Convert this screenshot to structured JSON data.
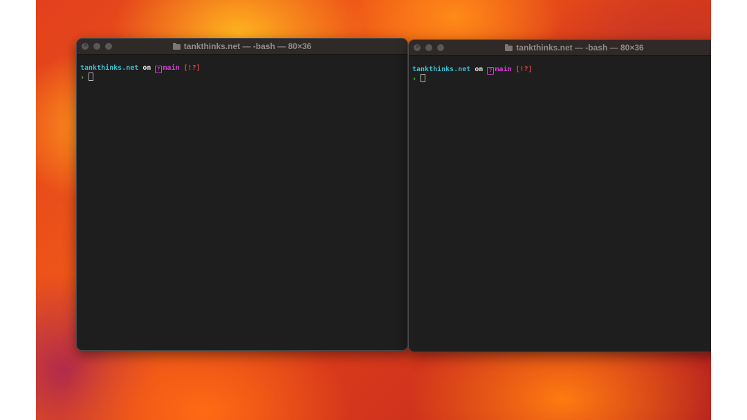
{
  "windows": [
    {
      "title": "tankthinks.net — -bash — 80×36",
      "prompt": {
        "host": "tankthinks.net",
        "on": "on",
        "branch_icon": "?",
        "branch": "main",
        "status": "[!?]",
        "symbol": "›"
      }
    },
    {
      "title": "tankthinks.net — -bash — 80×36",
      "prompt": {
        "host": "tankthinks.net",
        "on": "on",
        "branch_icon": "?",
        "branch": "main",
        "status": "[!?]",
        "symbol": "›"
      }
    }
  ],
  "colors": {
    "terminal_bg": "#1e1e1e",
    "titlebar_bg": "#2f2a28",
    "host": "#3dbfd0",
    "branch": "#d83ad8",
    "status": "#e0443c",
    "prompt_symbol": "#52c93a"
  },
  "icons": {
    "title_icon": "folder-icon",
    "traffic_lights": [
      "close-icon",
      "minimize-icon",
      "zoom-icon"
    ]
  }
}
